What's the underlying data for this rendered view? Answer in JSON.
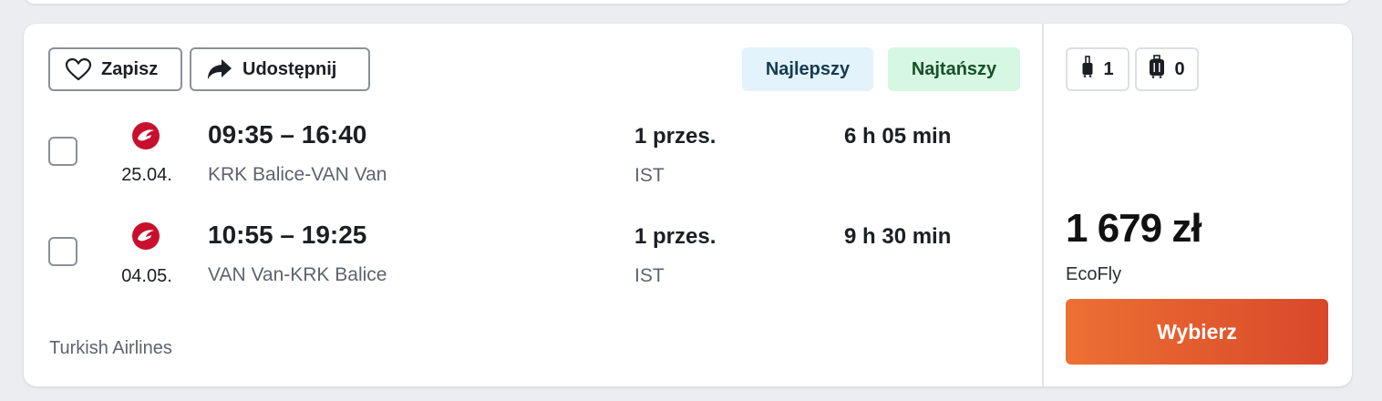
{
  "actions": {
    "save_label": "Zapisz",
    "share_label": "Udostępnij"
  },
  "badges": {
    "best": "Najlepszy",
    "cheapest": "Najtańszy"
  },
  "flights": [
    {
      "time_range": "09:35 – 16:40",
      "route": "KRK Balice-VAN Van",
      "date": "25.04.",
      "stops": "1 przes.",
      "via": "IST",
      "duration": "6 h 05 min"
    },
    {
      "time_range": "10:55 – 19:25",
      "route": "VAN Van-KRK Balice",
      "date": "04.05.",
      "stops": "1 przes.",
      "via": "IST",
      "duration": "9 h 30 min"
    }
  ],
  "airline": "Turkish Airlines",
  "baggage": {
    "hand": "1",
    "checked": "0"
  },
  "price": {
    "amount": "1 679 zł",
    "fare": "EcoFly",
    "select_label": "Wybierz"
  },
  "colors": {
    "accent_start": "#ec7033",
    "accent_end": "#d9482a",
    "airline_red": "#c8102e",
    "best_bg": "#e2f3fb",
    "cheapest_bg": "#d6f7e2"
  },
  "icons": {
    "save": "heart-icon",
    "share": "share-arrow-icon",
    "airline": "turkish-airlines-logo",
    "hand_bag": "cabin-bag-icon",
    "checked_bag": "suitcase-icon"
  }
}
